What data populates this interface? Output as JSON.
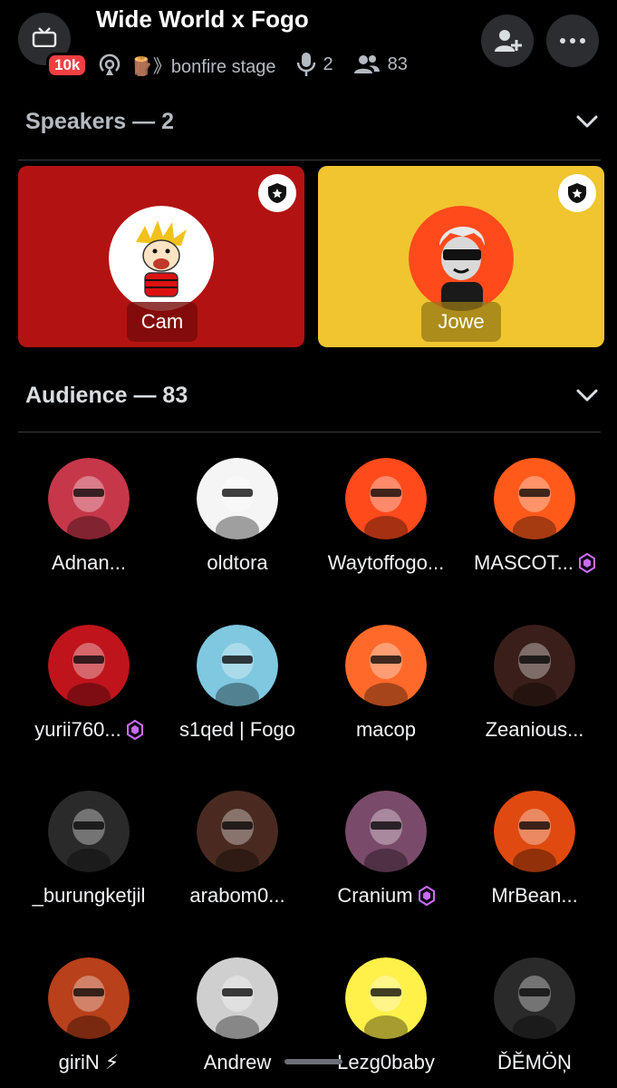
{
  "header": {
    "back_badge": "10k",
    "title": "Wide World x Fogo",
    "stage_name": "🪵》bonfire stage",
    "speaker_count": "2",
    "listener_count": "83"
  },
  "speakers_section": {
    "label": "Speakers — 2",
    "speakers": [
      {
        "name": "Cam",
        "card_color": "#b31212"
      },
      {
        "name": "Jowe",
        "card_color": "#f0c52f"
      }
    ]
  },
  "audience_section": {
    "label": "Audience — 83",
    "members": [
      {
        "name": "Adnan...",
        "gem": false
      },
      {
        "name": "oldtora",
        "gem": false
      },
      {
        "name": "Waytoffogo...",
        "gem": false
      },
      {
        "name": "MASCOT...",
        "gem": true
      },
      {
        "name": "yurii760...",
        "gem": true
      },
      {
        "name": "s1qed | Fogo",
        "gem": false
      },
      {
        "name": "macop",
        "gem": false
      },
      {
        "name": "Zeanious...",
        "gem": false
      },
      {
        "name": "_burungketjil",
        "gem": false
      },
      {
        "name": "arabom0...",
        "gem": false
      },
      {
        "name": "Cranium",
        "gem": true
      },
      {
        "name": "MrBean...",
        "gem": false
      },
      {
        "name": "giriN ⚡",
        "gem": false
      },
      {
        "name": "Andrew",
        "gem": false
      },
      {
        "name": "Lezg0baby",
        "gem": false
      },
      {
        "name": "ĎĔMÖŅ",
        "gem": false
      }
    ]
  },
  "colors": {
    "background": "#000000",
    "button_bg": "#2b2d31",
    "badge_red": "#f23f43",
    "gem": "#c86bf5"
  }
}
